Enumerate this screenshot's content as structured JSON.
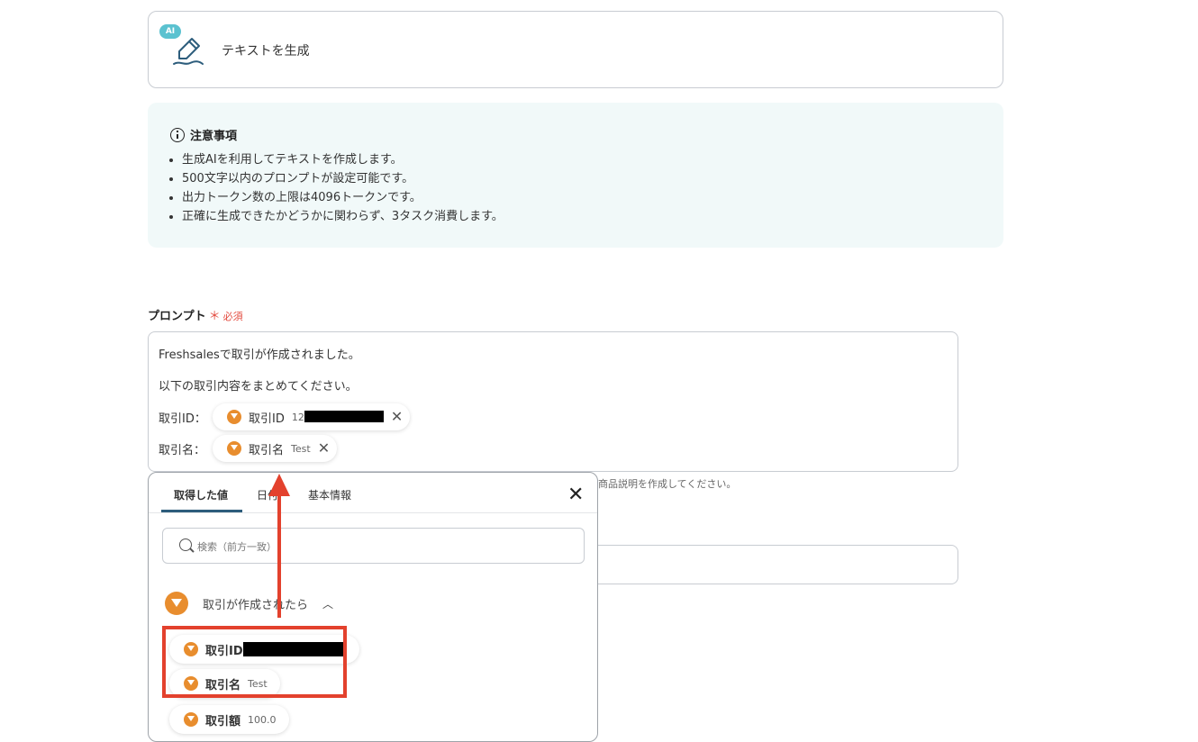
{
  "action": {
    "badge": "AI",
    "title": "テキストを生成"
  },
  "notice": {
    "heading": "注意事項",
    "items": [
      "生成AIを利用してテキストを作成します。",
      "500文字以内のプロンプトが設定可能です。",
      "出力トークン数の上限は4096トークンです。",
      "正確に生成できたかどうかに関わらず、3タスク消費します。"
    ]
  },
  "prompt": {
    "label": "プロンプト",
    "required_mark": "＊",
    "required_text": "必須",
    "lines": [
      "Freshsalesで取引が作成されました。",
      "以下の取引内容をまとめてください。",
      "取引ID：",
      "取引名："
    ],
    "pills": [
      {
        "name": "取引ID",
        "value": "12"
      },
      {
        "name": "取引名",
        "value": "Test"
      }
    ],
    "hint": "商品説明を作成してください。"
  },
  "panel": {
    "tabs": [
      "取得した値",
      "日付",
      "基本情報"
    ],
    "search_placeholder": "検索（前方一致）",
    "group_label": "取引が作成されたら",
    "items": [
      {
        "name": "取引ID",
        "value": ""
      },
      {
        "name": "取引名",
        "value": "Test"
      },
      {
        "name": "取引額",
        "value": "100.0"
      }
    ]
  },
  "colors": {
    "accent": "#e3412d",
    "brand_orange": "#e88d2e",
    "ai_badge": "#5bc2d0",
    "notice_bg": "#f1f9f9"
  }
}
